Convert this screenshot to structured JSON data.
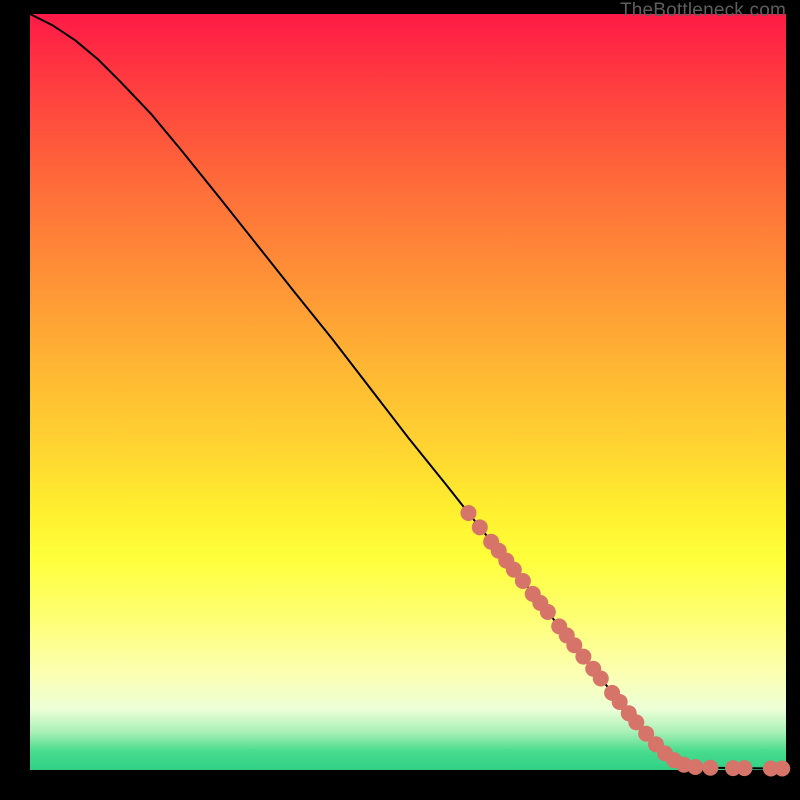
{
  "attribution": "TheBottleneck.com",
  "chart_data": {
    "type": "line",
    "xlim": [
      0,
      100
    ],
    "ylim": [
      0,
      100
    ],
    "curve": [
      {
        "x": 0,
        "y": 100
      },
      {
        "x": 3,
        "y": 98.5
      },
      {
        "x": 6,
        "y": 96.5
      },
      {
        "x": 9,
        "y": 94
      },
      {
        "x": 12,
        "y": 91
      },
      {
        "x": 16,
        "y": 86.8
      },
      {
        "x": 20,
        "y": 82
      },
      {
        "x": 25,
        "y": 75.8
      },
      {
        "x": 30,
        "y": 69.5
      },
      {
        "x": 35,
        "y": 63.2
      },
      {
        "x": 40,
        "y": 57
      },
      {
        "x": 45,
        "y": 50.5
      },
      {
        "x": 50,
        "y": 44
      },
      {
        "x": 55,
        "y": 37.8
      },
      {
        "x": 58,
        "y": 34
      },
      {
        "x": 62,
        "y": 29
      },
      {
        "x": 66,
        "y": 24
      },
      {
        "x": 70,
        "y": 19
      },
      {
        "x": 74,
        "y": 14
      },
      {
        "x": 78,
        "y": 9
      },
      {
        "x": 82,
        "y": 4.5
      },
      {
        "x": 85,
        "y": 1.5
      },
      {
        "x": 87,
        "y": 0.5
      },
      {
        "x": 90,
        "y": 0.3
      },
      {
        "x": 94,
        "y": 0.25
      },
      {
        "x": 98,
        "y": 0.2
      },
      {
        "x": 100,
        "y": 0.2
      }
    ],
    "markers": [
      {
        "x": 58,
        "y": 34
      },
      {
        "x": 59.5,
        "y": 32.1
      },
      {
        "x": 61,
        "y": 30.2
      },
      {
        "x": 62,
        "y": 29
      },
      {
        "x": 63,
        "y": 27.7
      },
      {
        "x": 64,
        "y": 26.5
      },
      {
        "x": 65.2,
        "y": 25
      },
      {
        "x": 66.5,
        "y": 23.3
      },
      {
        "x": 67.5,
        "y": 22.1
      },
      {
        "x": 68.5,
        "y": 20.9
      },
      {
        "x": 70,
        "y": 19
      },
      {
        "x": 71,
        "y": 17.8
      },
      {
        "x": 72,
        "y": 16.5
      },
      {
        "x": 73.2,
        "y": 15
      },
      {
        "x": 74.5,
        "y": 13.4
      },
      {
        "x": 75.5,
        "y": 12.1
      },
      {
        "x": 77,
        "y": 10.2
      },
      {
        "x": 78,
        "y": 9
      },
      {
        "x": 79.2,
        "y": 7.5
      },
      {
        "x": 80.2,
        "y": 6.3
      },
      {
        "x": 81.5,
        "y": 4.8
      },
      {
        "x": 82.8,
        "y": 3.4
      },
      {
        "x": 84,
        "y": 2.2
      },
      {
        "x": 85.2,
        "y": 1.3
      },
      {
        "x": 86.5,
        "y": 0.7
      },
      {
        "x": 88,
        "y": 0.4
      },
      {
        "x": 90,
        "y": 0.3
      },
      {
        "x": 93,
        "y": 0.25
      },
      {
        "x": 94.5,
        "y": 0.25
      },
      {
        "x": 98,
        "y": 0.2
      },
      {
        "x": 99.5,
        "y": 0.2
      }
    ],
    "marker_color": "#d67469",
    "line_color": "#000000"
  }
}
